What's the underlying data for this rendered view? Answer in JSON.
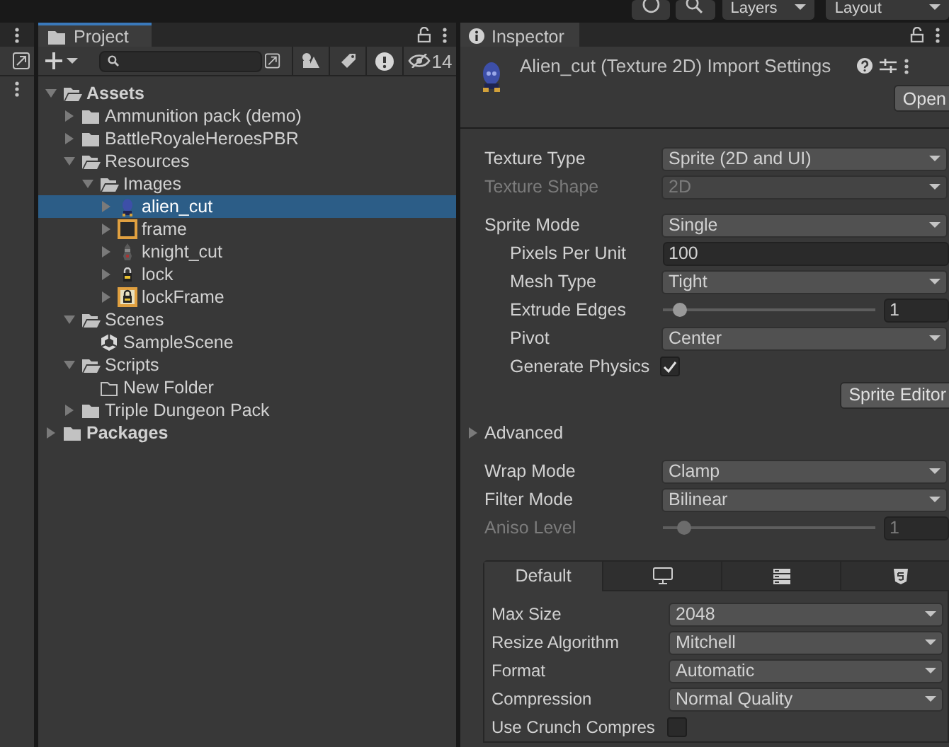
{
  "toolbar": {
    "layers": "Layers",
    "layout": "Layout"
  },
  "project": {
    "tab": "Project",
    "hidden_count": "14",
    "tree": [
      {
        "label": "Assets",
        "kind": "folder",
        "expanded": true,
        "selected": false,
        "children": [
          {
            "label": "Ammunition pack (demo)",
            "kind": "folder",
            "expanded": false,
            "selected": false
          },
          {
            "label": "BattleRoyaleHeroesPBR",
            "kind": "folder",
            "expanded": false,
            "selected": false
          },
          {
            "label": "Resources",
            "kind": "folder",
            "expanded": true,
            "selected": false,
            "children": [
              {
                "label": "Images",
                "kind": "folder",
                "expanded": true,
                "selected": false,
                "children": [
                  {
                    "label": "alien_cut",
                    "kind": "character",
                    "expanded": false,
                    "selected": true
                  },
                  {
                    "label": "frame",
                    "kind": "frame",
                    "expanded": false,
                    "selected": false
                  },
                  {
                    "label": "knight_cut",
                    "kind": "knight",
                    "expanded": false,
                    "selected": false
                  },
                  {
                    "label": "lock",
                    "kind": "lock",
                    "expanded": false,
                    "selected": false
                  },
                  {
                    "label": "lockFrame",
                    "kind": "framed-lock",
                    "expanded": false,
                    "selected": false
                  }
                ]
              }
            ]
          },
          {
            "label": "Scenes",
            "kind": "folder",
            "expanded": true,
            "selected": false,
            "children": [
              {
                "label": "SampleScene",
                "kind": "scene",
                "selected": false
              }
            ]
          },
          {
            "label": "Scripts",
            "kind": "folder",
            "expanded": true,
            "selected": false,
            "children": [
              {
                "label": "New Folder",
                "kind": "empty-folder",
                "selected": false
              }
            ]
          },
          {
            "label": "Triple Dungeon Pack",
            "kind": "folder",
            "expanded": false,
            "selected": false
          }
        ]
      },
      {
        "label": "Packages",
        "kind": "folder",
        "expanded": false,
        "selected": false
      }
    ]
  },
  "inspector": {
    "tab": "Inspector",
    "title": "Alien_cut (Texture 2D) Import Settings",
    "open_button": "Open",
    "groups": [
      [
        {
          "label": "Texture Type",
          "kind": "dropdown",
          "value": "Sprite (2D and UI)",
          "disabled": false
        },
        {
          "label": "Texture Shape",
          "kind": "dropdown",
          "value": "2D",
          "disabled": true
        }
      ],
      [
        {
          "label": "Sprite Mode",
          "kind": "dropdown",
          "value": "Single",
          "disabled": false,
          "children": [
            {
              "label": "Pixels Per Unit",
              "kind": "field",
              "value": "100",
              "disabled": false
            },
            {
              "label": "Mesh Type",
              "kind": "dropdown",
              "value": "Tight",
              "disabled": false
            },
            {
              "label": "Extrude Edges",
              "kind": "slider",
              "value": "1",
              "level": 0.06,
              "disabled": false
            },
            {
              "label": "Pivot",
              "kind": "dropdown",
              "value": "Center",
              "disabled": false
            },
            {
              "label": "Generate Physics",
              "kind": "checkbox",
              "checked": true,
              "disabled": false
            }
          ]
        },
        {
          "kind": "button",
          "value": "Sprite Editor"
        }
      ],
      [
        {
          "label": "Advanced",
          "kind": "foldout",
          "expanded": false
        }
      ],
      [
        {
          "label": "Wrap Mode",
          "kind": "dropdown",
          "value": "Clamp",
          "disabled": false
        },
        {
          "label": "Filter Mode",
          "kind": "dropdown",
          "value": "Bilinear",
          "disabled": false
        },
        {
          "label": "Aniso Level",
          "kind": "slider",
          "value": "1",
          "level": 0.08,
          "disabled": true
        }
      ]
    ],
    "platform_tabs": [
      {
        "kind": "text",
        "label": "Default",
        "selected": true
      },
      {
        "kind": "monitor",
        "selected": false
      },
      {
        "kind": "server",
        "selected": false
      },
      {
        "kind": "html5",
        "selected": false
      }
    ],
    "platform_rows": [
      {
        "label": "Max Size",
        "kind": "dropdown",
        "value": "2048",
        "disabled": false
      },
      {
        "label": "Resize Algorithm",
        "kind": "dropdown",
        "value": "Mitchell",
        "disabled": false
      },
      {
        "label": "Format",
        "kind": "dropdown",
        "value": "Automatic",
        "disabled": false
      },
      {
        "label": "Compression",
        "kind": "dropdown",
        "value": "Normal Quality",
        "disabled": false
      },
      {
        "label": "Use Crunch Compres",
        "kind": "checkbox",
        "checked": false,
        "disabled": false
      }
    ]
  }
}
